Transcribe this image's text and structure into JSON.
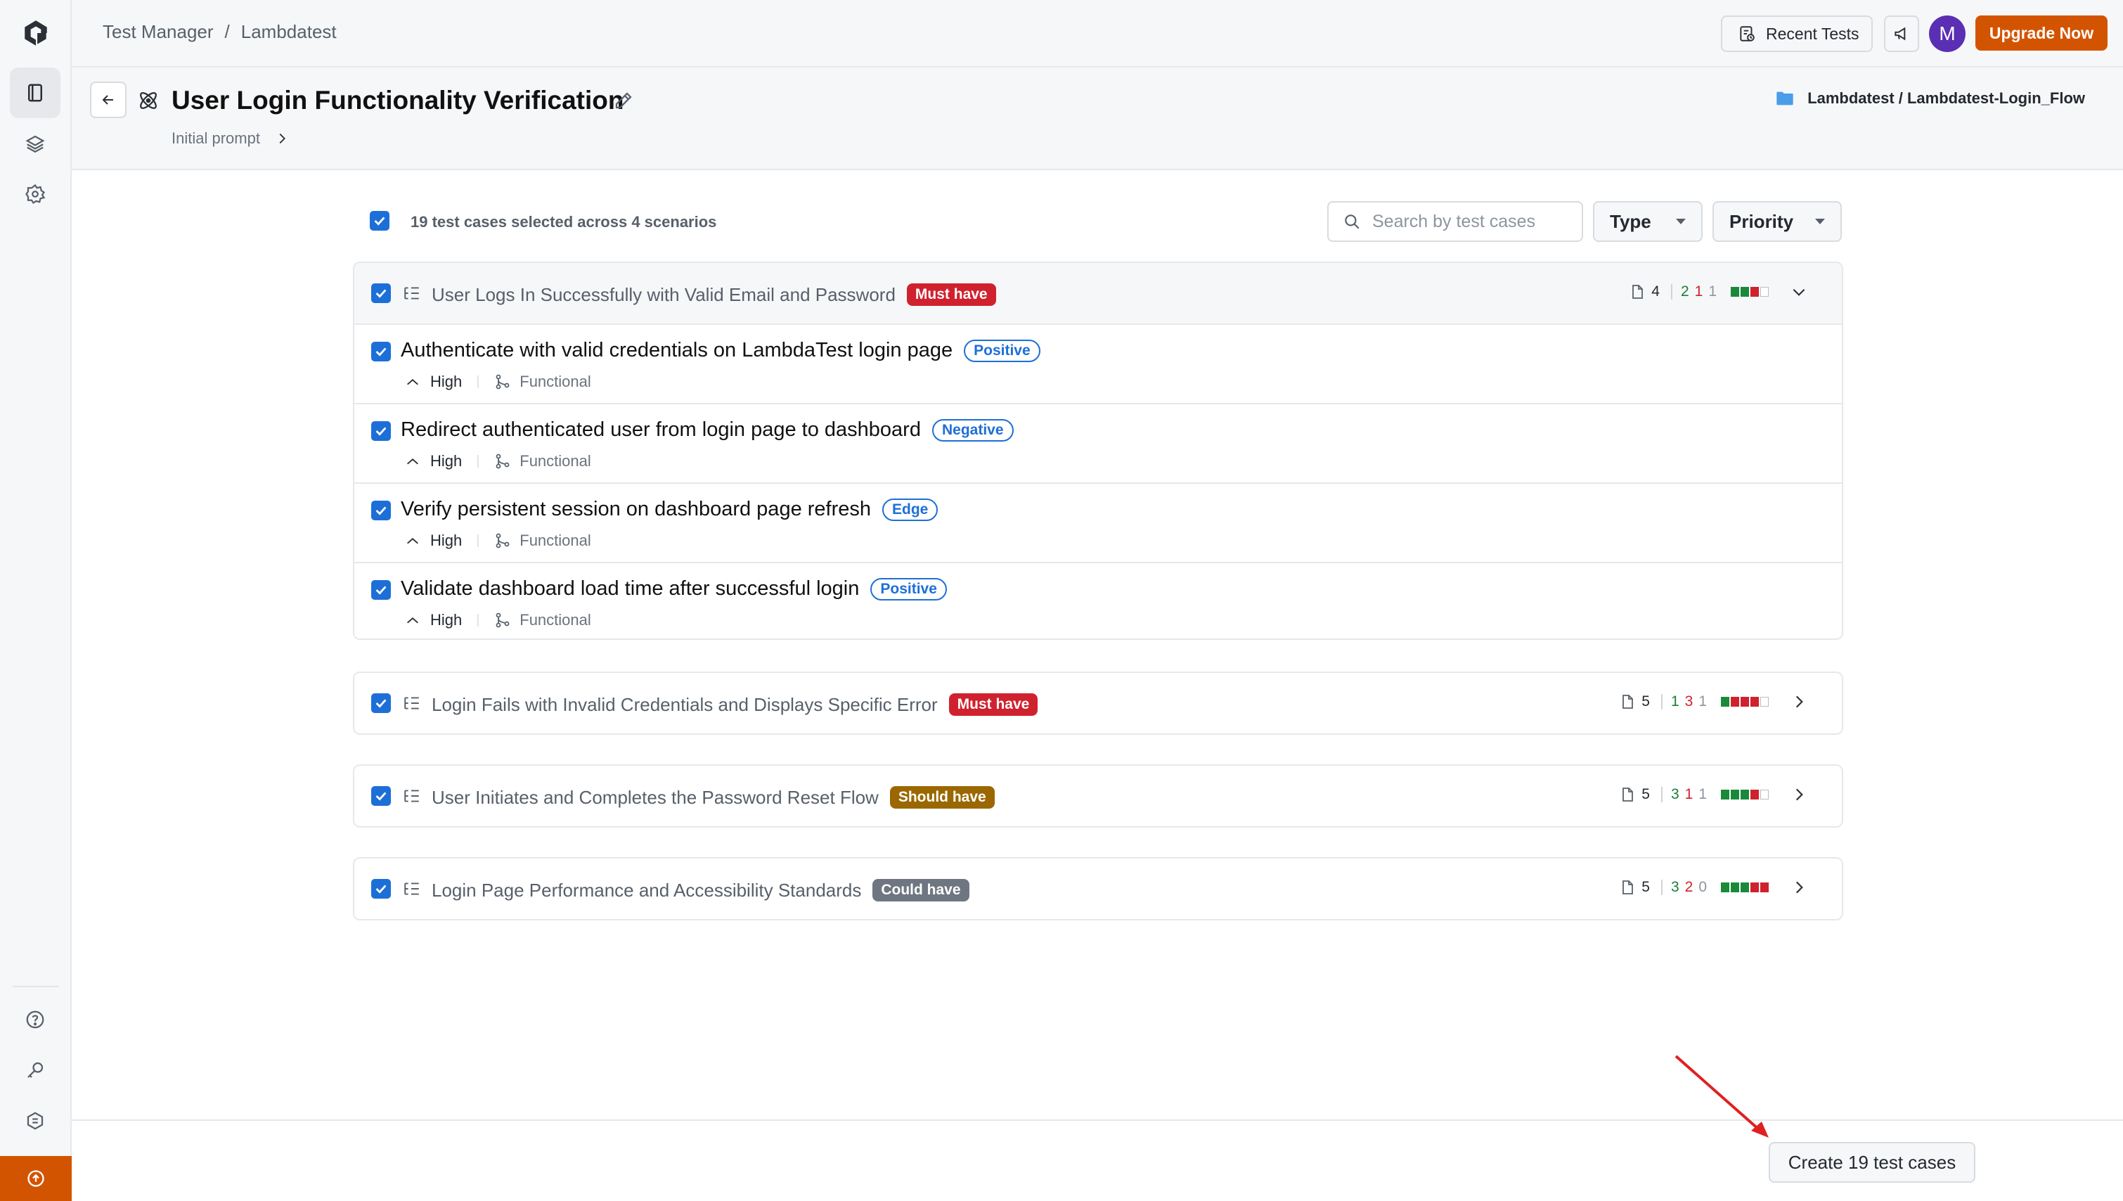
{
  "breadcrumb": {
    "root": "Test Manager",
    "separator": "/",
    "current": "Lambdatest"
  },
  "topbar": {
    "recent_tests_label": "Recent Tests",
    "avatar_initial": "M",
    "upgrade_label": "Upgrade Now"
  },
  "header": {
    "title": "User Login Functionality Verification",
    "initial_prompt_label": "Initial prompt",
    "folder_path": "Lambdatest / Lambdatest-Login_Flow"
  },
  "filters": {
    "selected_summary": "19 test cases selected across 4 scenarios",
    "search_placeholder": "Search by test cases",
    "type_label": "Type",
    "priority_label": "Priority"
  },
  "colors": {
    "accent": "#1d6fd8",
    "upgrade": "#d35400",
    "must_have": "#cf222e",
    "should_have": "#9a6700",
    "could_have": "#6e7781",
    "positive": "#1a7f37",
    "negative": "#cf222e"
  },
  "scenarios": [
    {
      "title": "User Logs In Successfully with Valid Email and Password",
      "priority": "Must have",
      "count": "4",
      "pos": "2",
      "neg": "1",
      "edge": "1",
      "expanded": true,
      "cases": [
        {
          "title": "Authenticate with valid credentials on LambdaTest login page",
          "type": "Positive",
          "priority": "High",
          "category": "Functional"
        },
        {
          "title": "Redirect authenticated user from login page to dashboard",
          "type": "Negative",
          "priority": "High",
          "category": "Functional"
        },
        {
          "title": "Verify persistent session on dashboard page refresh",
          "type": "Edge",
          "priority": "High",
          "category": "Functional"
        },
        {
          "title": "Validate dashboard load time after successful login",
          "type": "Positive",
          "priority": "High",
          "category": "Functional"
        }
      ]
    },
    {
      "title": "Login Fails with Invalid Credentials and Displays Specific Error",
      "priority": "Must have",
      "count": "5",
      "pos": "1",
      "neg": "3",
      "edge": "1",
      "expanded": false
    },
    {
      "title": "User Initiates and Completes the Password Reset Flow",
      "priority": "Should have",
      "count": "5",
      "pos": "3",
      "neg": "1",
      "edge": "1",
      "expanded": false
    },
    {
      "title": "Login Page Performance and Accessibility Standards",
      "priority": "Could have",
      "count": "5",
      "pos": "3",
      "neg": "2",
      "edge": "0",
      "expanded": false
    }
  ],
  "footer": {
    "create_label": "Create 19 test cases"
  },
  "icons": [
    "app-logo-icon",
    "panel-icon",
    "layers-icon",
    "settings-icon",
    "help-icon",
    "key-icon",
    "integrations-icon",
    "upgrade-icon",
    "back-arrow-icon",
    "atom-icon",
    "pencil-icon",
    "folder-icon",
    "search-icon",
    "list-icon",
    "test-file-icon",
    "chevron-icon",
    "chevron-up-icon",
    "branch-icon",
    "megaphone-icon",
    "history-icon"
  ]
}
